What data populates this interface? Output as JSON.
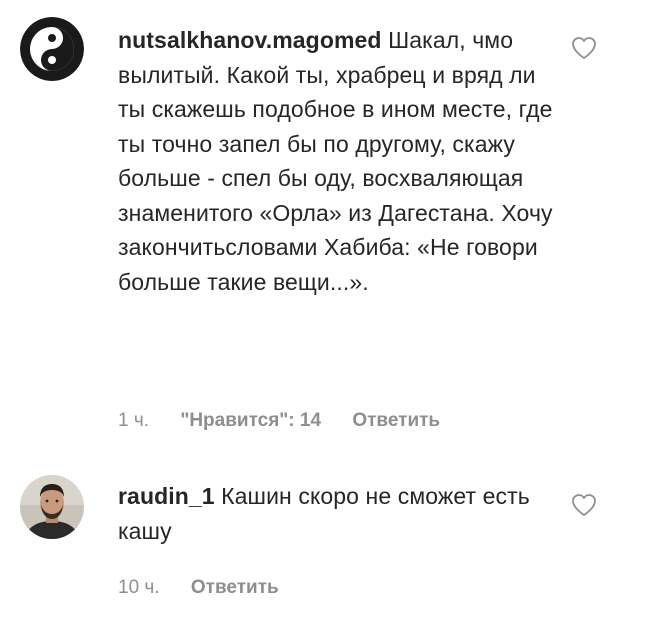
{
  "comments": [
    {
      "username": "nutsalkhanov.magomed",
      "text": "Шакал, чмо вылитый. Какой ты, храбрец и вряд ли ты скажешь подобное в ином месте, где ты точно запел бы по другому, скажу больше - спел бы оду, восхваляющая знаменитого «Орла» из Дагестана. Хочу закончитьсловами Хабиба: «Не говори больше такие вещи...».",
      "time": "1 ч.",
      "likes": "\"Нравится\": 14",
      "reply": "Ответить",
      "avatar_icon": "yin-yang-icon"
    },
    {
      "username": "raudin_1",
      "text": "Кашин скоро не сможет есть кашу",
      "time": "10 ч.",
      "reply": "Ответить",
      "avatar_icon": "user-photo"
    }
  ],
  "colors": {
    "text": "#262626",
    "meta": "#8e8e8e",
    "heart_stroke": "#8e8e8e"
  }
}
